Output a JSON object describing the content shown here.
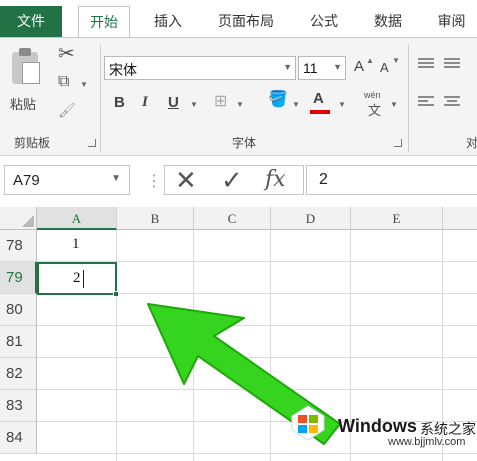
{
  "tabs": [
    {
      "label": "文件"
    },
    {
      "label": "开始"
    },
    {
      "label": "插入"
    },
    {
      "label": "页面布局"
    },
    {
      "label": "公式"
    },
    {
      "label": "数据"
    },
    {
      "label": "审阅"
    }
  ],
  "ribbon": {
    "clipboard": {
      "paste_label": "粘贴",
      "group_label": "剪贴板"
    },
    "font": {
      "font_name": "宋体",
      "font_size": "11",
      "bold": "B",
      "italic": "I",
      "underline": "U",
      "font_color": "A",
      "grow_font": "A",
      "shrink_font": "A",
      "phonetic_top": "wén",
      "phonetic_bottom": "文",
      "group_label": "字体"
    },
    "alignment": {
      "group_label_partial": "对"
    }
  },
  "formula_bar": {
    "name_box": "A79",
    "fx_label": "fx",
    "content": "2"
  },
  "grid": {
    "columns": [
      "A",
      "B",
      "C",
      "D",
      "E"
    ],
    "rows": [
      "78",
      "79",
      "80",
      "81",
      "82",
      "83",
      "84"
    ],
    "cells": {
      "A78": "1",
      "A79": "2"
    },
    "selected_cell": "A79"
  },
  "watermark": {
    "brand": "Windows",
    "brand_cn": "系统之家",
    "url": "www.bjjmlv.com"
  },
  "colors": {
    "accent_green": "#217346",
    "arrow_green": "#2ecc1a",
    "font_color_red": "#e00000"
  }
}
